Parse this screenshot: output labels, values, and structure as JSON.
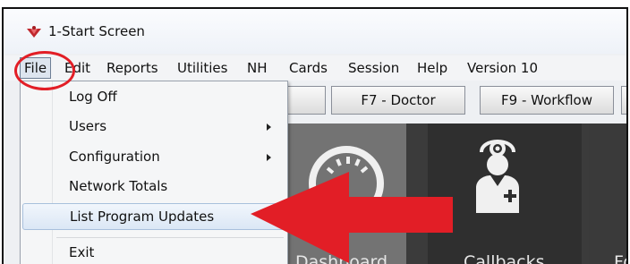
{
  "window": {
    "title": "1-Start Screen"
  },
  "menubar": {
    "items": [
      "File",
      "Edit",
      "Reports",
      "Utilities",
      "NH",
      "Cards",
      "Session",
      "Help",
      "Version 10"
    ]
  },
  "toolbar": {
    "buttons": [
      "F7 - Doctor",
      "F9 - Workflow"
    ]
  },
  "file_menu": {
    "items": [
      "Log Off",
      "Users",
      "Configuration",
      "Network Totals",
      "List Program Updates",
      "Exit"
    ],
    "highlighted": "List Program Updates"
  },
  "tiles": {
    "dashboard_label": "Dashboard",
    "callbacks_label": "Callbacks",
    "third_label": "Fo"
  },
  "colors": {
    "annotation": "#e21e26",
    "tile_dashboard": "#737373",
    "tile_callbacks": "#2f2f2f"
  },
  "icons": [
    "app-icon",
    "speedometer-icon",
    "doctor-icon",
    "submenu-arrow-icon"
  ]
}
